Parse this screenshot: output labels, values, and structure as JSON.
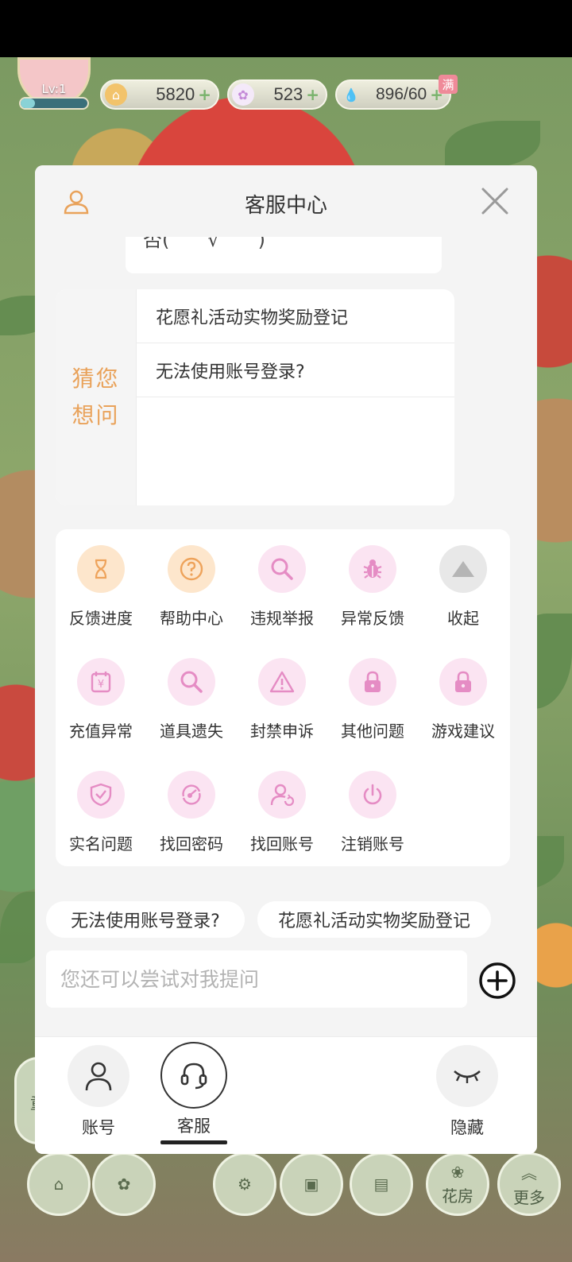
{
  "hud": {
    "level": "Lv:1",
    "level_progress": 0.22,
    "coins": "5820",
    "stars": "523",
    "water": "896/60",
    "water_badge": "满"
  },
  "game_dock": {
    "flower_room": "花房",
    "more": "更多",
    "partial_left": "童"
  },
  "modal": {
    "title": "客服中心",
    "partial_text": "否(　　√　　)",
    "guess": {
      "label": "猜您想问",
      "items": [
        "花愿礼活动实物奖励登记",
        "无法使用账号登录?"
      ]
    },
    "grid": [
      {
        "label": "反馈进度",
        "icon": "hourglass-icon"
      },
      {
        "label": "帮助中心",
        "icon": "question-icon"
      },
      {
        "label": "违规举报",
        "icon": "search-icon"
      },
      {
        "label": "异常反馈",
        "icon": "bug-icon"
      },
      {
        "label": "收起",
        "icon": "collapse-up-icon"
      },
      {
        "label": "充值异常",
        "icon": "recharge-icon"
      },
      {
        "label": "道具遗失",
        "icon": "search-icon"
      },
      {
        "label": "封禁申诉",
        "icon": "warning-icon"
      },
      {
        "label": "其他问题",
        "icon": "lock-icon"
      },
      {
        "label": "游戏建议",
        "icon": "lock-icon"
      },
      {
        "label": "实名问题",
        "icon": "shield-check-icon"
      },
      {
        "label": "找回密码",
        "icon": "key-refresh-icon"
      },
      {
        "label": "找回账号",
        "icon": "user-refresh-icon"
      },
      {
        "label": "注销账号",
        "icon": "power-icon"
      }
    ],
    "chips": [
      "无法使用账号登录?",
      "花愿礼活动实物奖励登记"
    ],
    "input_placeholder": "您还可以尝试对我提问",
    "nav": {
      "account": "账号",
      "service": "客服",
      "hide": "隐藏"
    }
  },
  "colors": {
    "accent_orange": "#e9a25a",
    "orange_icon_bg": "#fde6cc",
    "pink_icon_bg": "#fbe4f2",
    "pink_icon_fg": "#e58cc4",
    "gray_icon_bg": "#e8e8e8"
  }
}
